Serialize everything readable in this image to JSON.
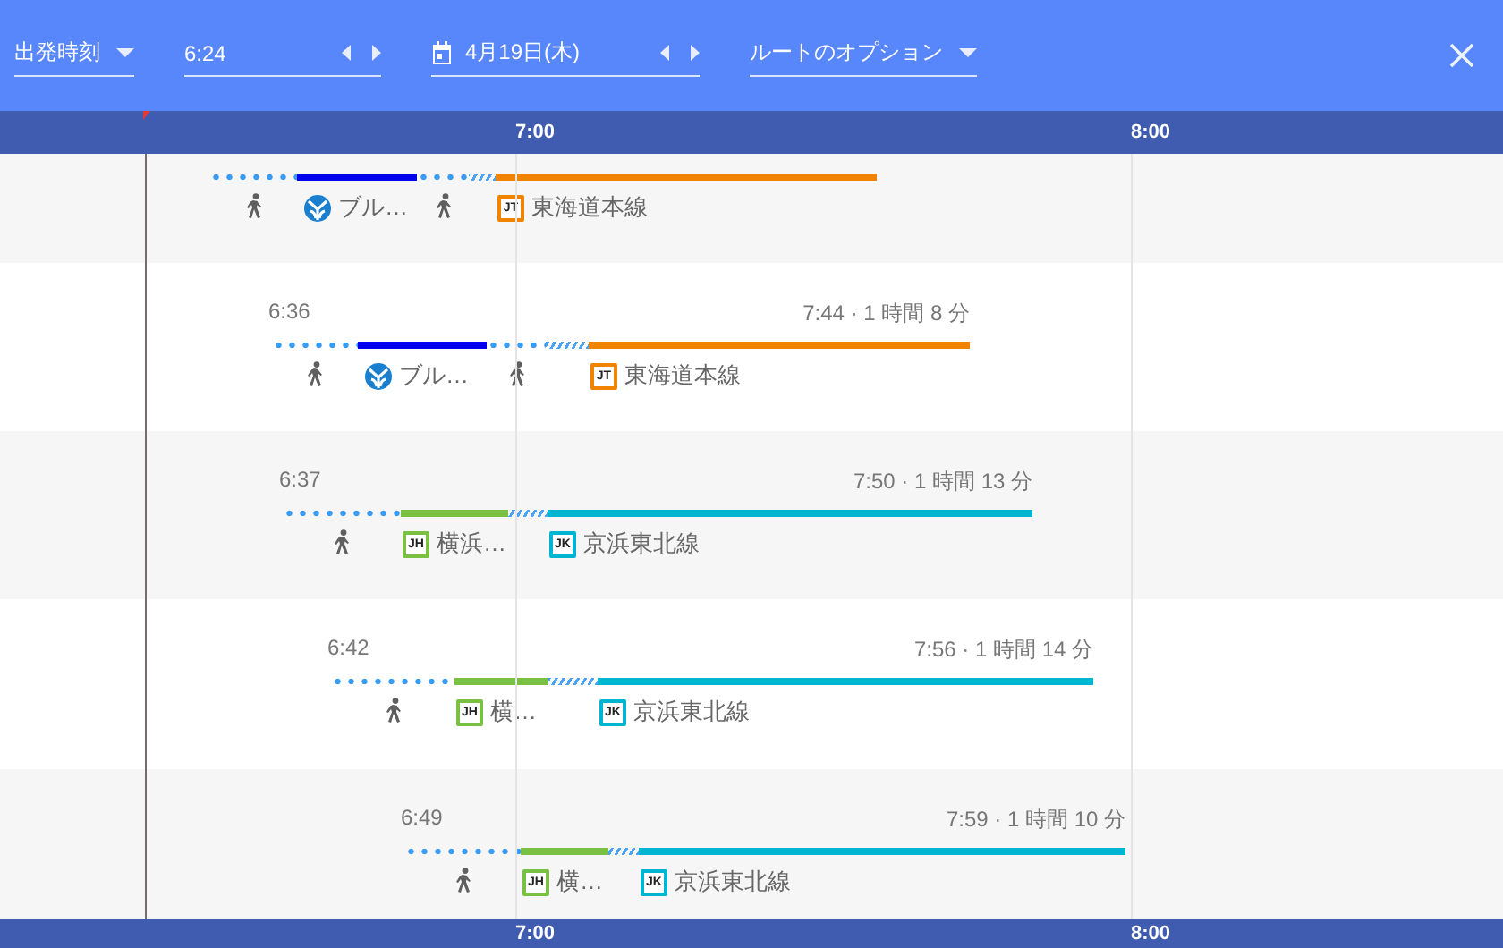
{
  "header": {
    "mode": {
      "label": "出発時刻"
    },
    "time": {
      "value": "6:24"
    },
    "date": {
      "value": "4月19日(木)"
    },
    "options": {
      "label": "ルートのオプション"
    }
  },
  "axis_top": {
    "ticks": [
      "7:00",
      "8:00"
    ]
  },
  "routes": [
    {
      "segments": [
        {
          "kind": "walk"
        },
        {
          "kind": "metro",
          "color": "#0000ee",
          "label": "ブル…"
        },
        {
          "kind": "walk"
        },
        {
          "kind": "transfer"
        },
        {
          "kind": "rail",
          "color": "#f08300",
          "badge": "JT",
          "label": "東海道本線"
        }
      ]
    },
    {
      "depart": "6:36",
      "summary": "7:44 · 1 時間 8 分",
      "segments": [
        {
          "kind": "walk"
        },
        {
          "kind": "metro",
          "color": "#0000ee",
          "label": "ブル…"
        },
        {
          "kind": "walk"
        },
        {
          "kind": "transfer"
        },
        {
          "kind": "rail",
          "color": "#f08300",
          "badge": "JT",
          "label": "東海道本線"
        }
      ]
    },
    {
      "depart": "6:37",
      "summary": "7:50 · 1 時間 13 分",
      "segments": [
        {
          "kind": "walk"
        },
        {
          "kind": "rail",
          "color": "#7ac143",
          "badge": "JH",
          "label": "横浜…"
        },
        {
          "kind": "transfer"
        },
        {
          "kind": "rail",
          "color": "#00b5d1",
          "badge": "JK",
          "label": "京浜東北線"
        }
      ]
    },
    {
      "depart": "6:42",
      "summary": "7:56 · 1 時間 14 分",
      "segments": [
        {
          "kind": "walk"
        },
        {
          "kind": "rail",
          "color": "#7ac143",
          "badge": "JH",
          "label": "横…"
        },
        {
          "kind": "transfer"
        },
        {
          "kind": "rail",
          "color": "#00b5d1",
          "badge": "JK",
          "label": "京浜東北線"
        }
      ]
    },
    {
      "depart": "6:49",
      "summary": "7:59 · 1 時間 10 分",
      "segments": [
        {
          "kind": "walk"
        },
        {
          "kind": "rail",
          "color": "#7ac143",
          "badge": "JH",
          "label": "横…"
        },
        {
          "kind": "transfer"
        },
        {
          "kind": "rail",
          "color": "#00b5d1",
          "badge": "JK",
          "label": "京浜東北線"
        }
      ]
    }
  ],
  "axis_bottom": {
    "ticks": [
      "7:00",
      "8:00"
    ]
  }
}
